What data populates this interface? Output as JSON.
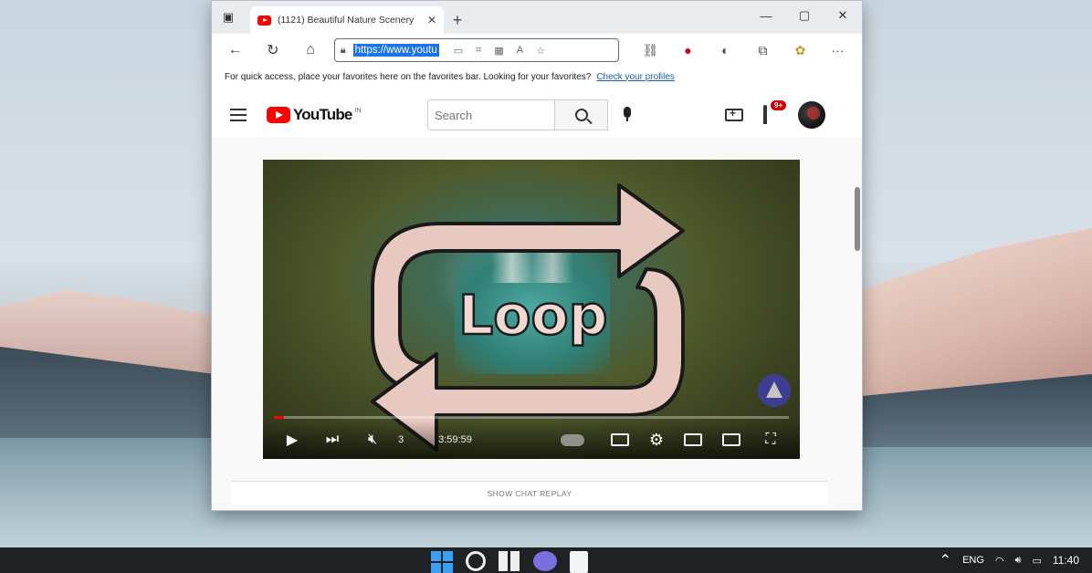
{
  "browser": {
    "tab_title": "(1121) Beautiful Nature Scenery",
    "tab_close": "✕",
    "new_tab": "+",
    "window_controls": [
      "—",
      "▢",
      "✕"
    ],
    "url": "https://www.youtu",
    "favorites_bar": {
      "message": "For quick access, place your favorites here on the favorites bar. Looking for your favorites?",
      "link": "Check your profiles"
    }
  },
  "youtube": {
    "logo_text": "YouTube",
    "logo_sup": "IN",
    "search_placeholder": "Search",
    "notification_count": "9+",
    "player": {
      "overlay_text": "Loop",
      "time": "3:59:59",
      "time_prefix": "3",
      "progress": 0.02
    },
    "show_chat_replay": "SHOW CHAT REPLAY"
  },
  "taskbar": {
    "language": "ENG",
    "time": "11:40"
  },
  "colors": {
    "youtube_red": "#ff0000",
    "url_highlight": "#1a73e8",
    "loop_arrow_fill": "#e8c9c0"
  },
  "icons": [
    "sidebar-toggle-icon",
    "back-icon",
    "refresh-icon",
    "home-icon",
    "lock-icon",
    "read-aloud-icon",
    "extensions-icon",
    "favorites-icon",
    "collections-icon",
    "profile-icon",
    "more-icon",
    "search-icon",
    "mic-icon",
    "create-icon",
    "bell-icon",
    "play-icon",
    "next-icon",
    "mute-icon",
    "settings-icon",
    "miniplayer-icon",
    "theater-icon",
    "fullscreen-icon"
  ]
}
